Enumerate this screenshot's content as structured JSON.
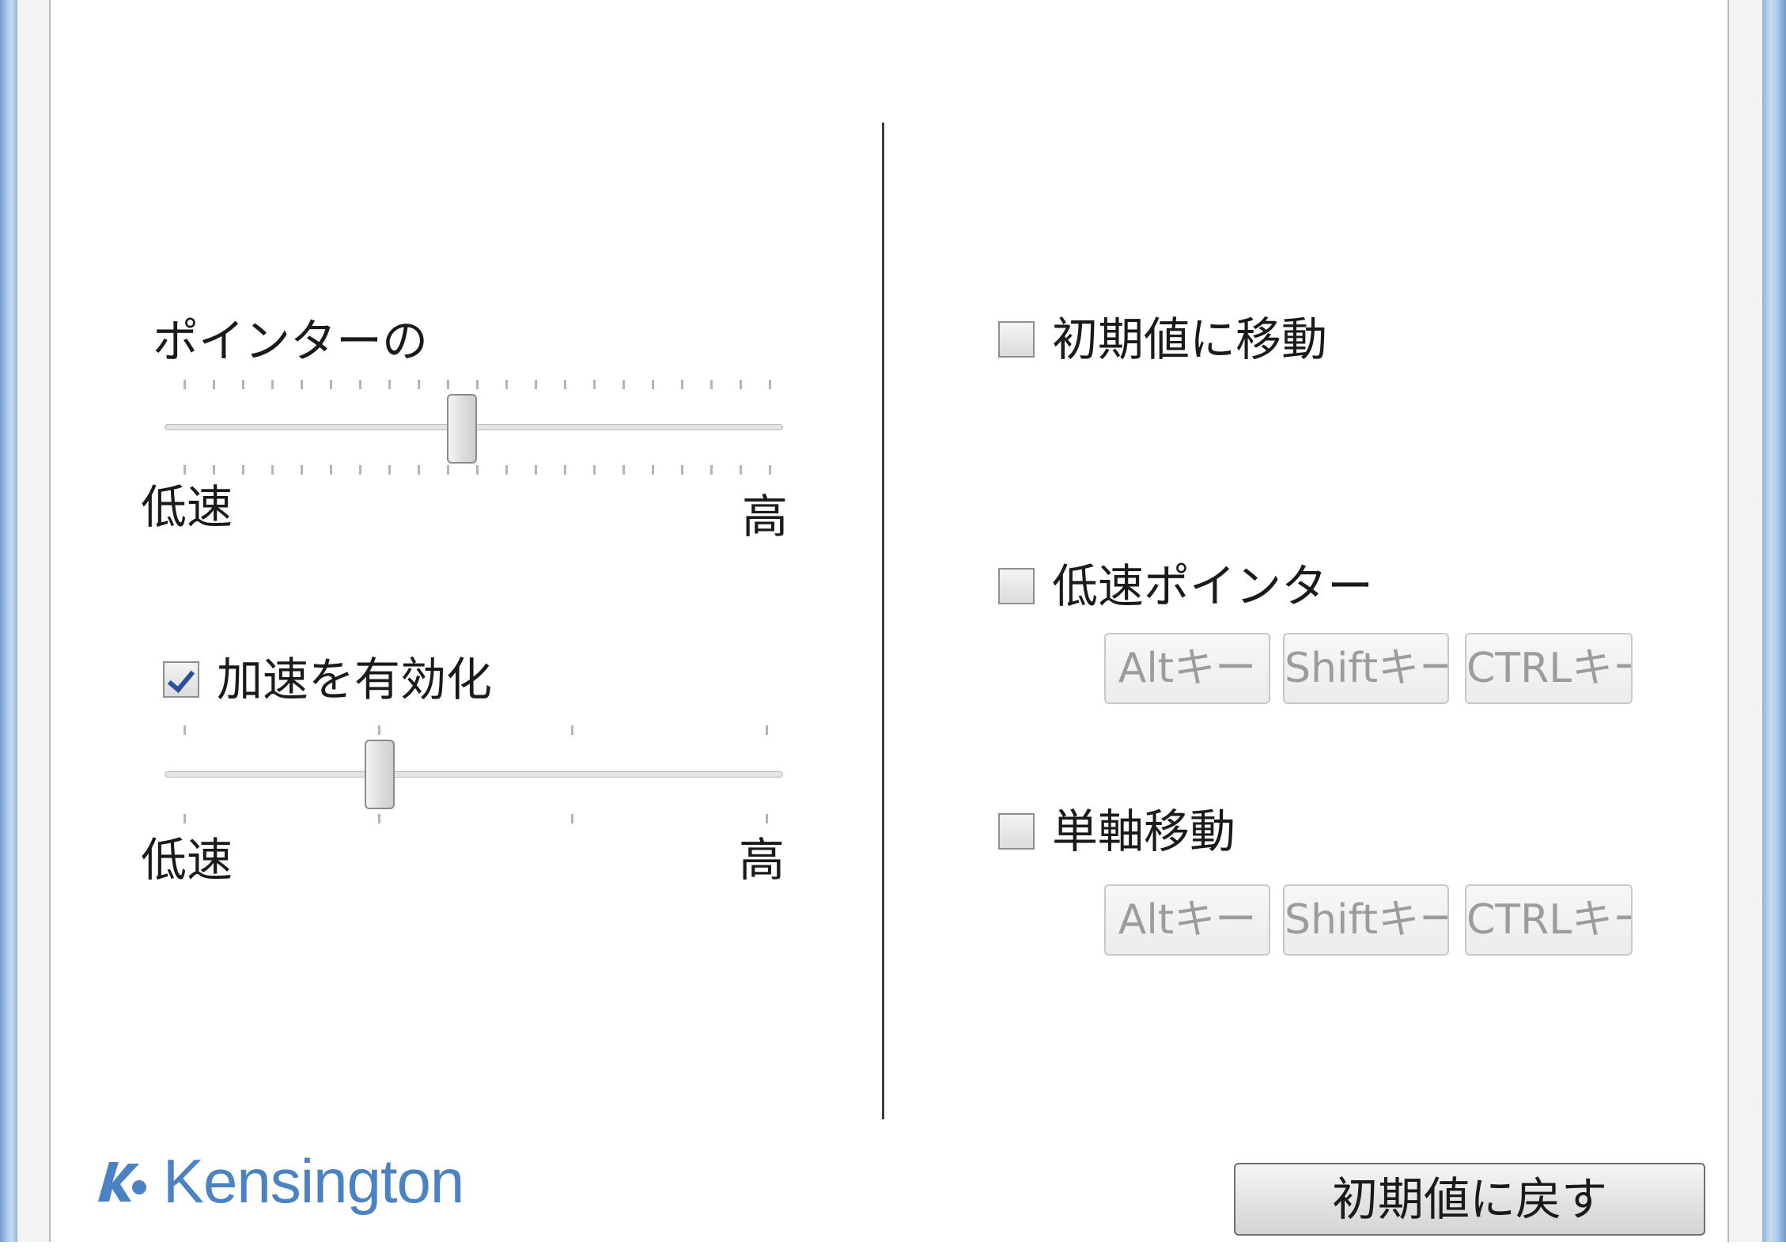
{
  "pointer_speed": {
    "label": "ポインターの",
    "low_label": "低速",
    "high_label": "高",
    "value_fraction": 0.48
  },
  "acceleration": {
    "checkbox_label": "加速を有効化",
    "checked": true,
    "low_label": "低速",
    "high_label": "高",
    "value_fraction": 0.34
  },
  "options": {
    "move_to_default": {
      "label": "初期値に移動",
      "checked": false
    },
    "slow_pointer": {
      "label": "低速ポインター",
      "checked": false,
      "keys": [
        "Altキー",
        "Shiftキー",
        "CTRLキー"
      ]
    },
    "single_axis": {
      "label": "単軸移動",
      "checked": false,
      "keys": [
        "Altキー",
        "Shiftキー",
        "CTRLキー"
      ]
    }
  },
  "footer": {
    "logo_text": "Kensington",
    "reset_label": "初期値に戻す"
  },
  "colors": {
    "logo": "#4b82c3",
    "checkmark": "#2b4f9e"
  }
}
